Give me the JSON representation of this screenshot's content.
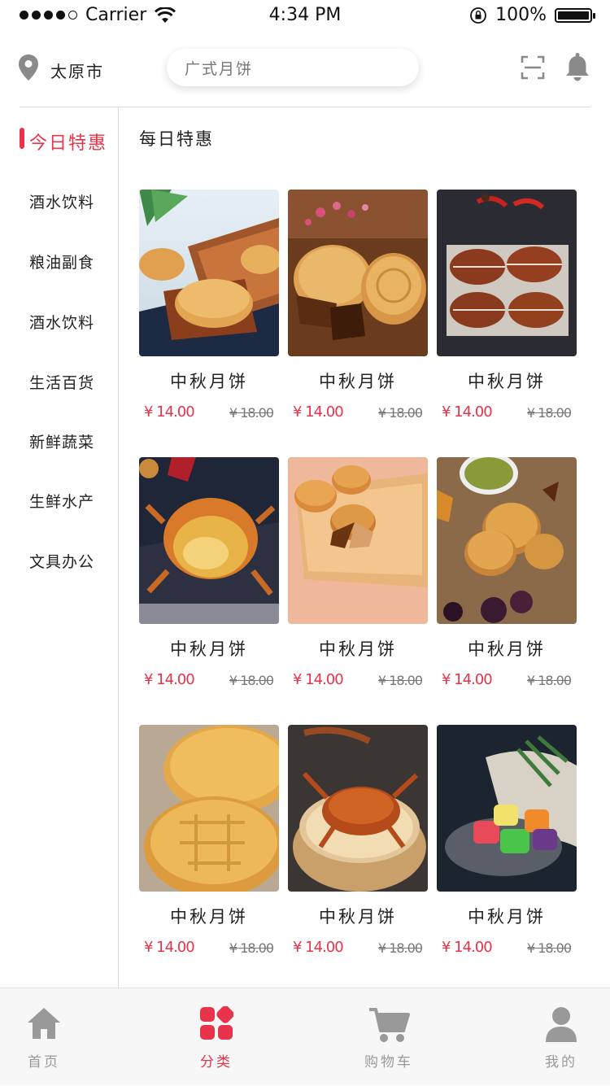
{
  "status_bar": {
    "carrier": "Carrier",
    "time": "4:34 PM",
    "battery": "100%"
  },
  "header": {
    "location": "太原市",
    "search_placeholder": "广式月饼",
    "icons": [
      "location-pin-icon",
      "scan-icon",
      "bell-icon"
    ]
  },
  "sidebar": {
    "active_index": 0,
    "items": [
      {
        "label": "今日特惠"
      },
      {
        "label": "酒水饮料"
      },
      {
        "label": "粮油副食"
      },
      {
        "label": "酒水饮料"
      },
      {
        "label": "生活百货"
      },
      {
        "label": "新鲜蔬菜"
      },
      {
        "label": "生鲜水产"
      },
      {
        "label": "文具办公"
      }
    ]
  },
  "main": {
    "section_title": "每日特惠",
    "products": [
      {
        "name": "中秋月饼",
        "price": "¥ 14.00",
        "original_price": "¥ 18.00",
        "image": "mooncake-tray"
      },
      {
        "name": "中秋月饼",
        "price": "¥ 14.00",
        "original_price": "¥ 18.00",
        "image": "mooncake-pair"
      },
      {
        "name": "中秋月饼",
        "price": "¥ 14.00",
        "original_price": "¥ 18.00",
        "image": "hairy-crabs-tied"
      },
      {
        "name": "中秋月饼",
        "price": "¥ 14.00",
        "original_price": "¥ 18.00",
        "image": "crab-plate"
      },
      {
        "name": "中秋月饼",
        "price": "¥ 14.00",
        "original_price": "¥ 18.00",
        "image": "mooncakes-board"
      },
      {
        "name": "中秋月饼",
        "price": "¥ 14.00",
        "original_price": "¥ 18.00",
        "image": "mooncakes-table"
      },
      {
        "name": "中秋月饼",
        "price": "¥ 14.00",
        "original_price": "¥ 18.00",
        "image": "mooncake-closeup"
      },
      {
        "name": "中秋月饼",
        "price": "¥ 14.00",
        "original_price": "¥ 18.00",
        "image": "crab-steamer"
      },
      {
        "name": "中秋月饼",
        "price": "¥ 14.00",
        "original_price": "¥ 18.00",
        "image": "colorful-mooncakes"
      }
    ]
  },
  "tabbar": {
    "active_index": 1,
    "items": [
      {
        "label": "首页",
        "icon": "home-icon"
      },
      {
        "label": "分类",
        "icon": "category-icon"
      },
      {
        "label": "购物车",
        "icon": "cart-icon"
      },
      {
        "label": "我的",
        "icon": "user-icon"
      }
    ]
  },
  "colors": {
    "accent": "#e8334a",
    "divider": "#dddddd",
    "tab_inactive": "#999999"
  }
}
